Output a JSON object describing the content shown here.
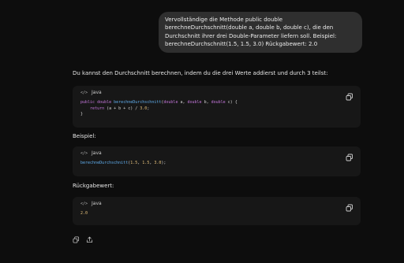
{
  "user_message": "Vervollständige die Methode public double berechneDurchschnitt(double a, double b, double c), die den Durchschnitt ihrer drei Double-Parameter liefern soll. Beispiel: berechneDurchschnitt(1.5, 1.5, 3.0) Rückgabewert: 2.0",
  "assistant": {
    "intro": "Du kannst den Durchschnitt berechnen, indem du die drei Werte addierst und durch 3 teilst:",
    "example_label": "Beispiel:",
    "return_label": "Rückgabewert:"
  },
  "code_blocks": [
    {
      "language": "Java",
      "lines": [
        [
          {
            "t": "public ",
            "c": "kw"
          },
          {
            "t": "double ",
            "c": "kw"
          },
          {
            "t": "berechneDurchschnitt",
            "c": "fn"
          },
          {
            "t": "(",
            "c": "pn"
          },
          {
            "t": "double ",
            "c": "kw"
          },
          {
            "t": "a, ",
            "c": "pn"
          },
          {
            "t": "double ",
            "c": "kw"
          },
          {
            "t": "b, ",
            "c": "pn"
          },
          {
            "t": "double ",
            "c": "kw"
          },
          {
            "t": "c) {",
            "c": "pn"
          }
        ],
        [
          {
            "t": "    ",
            "c": "pn"
          },
          {
            "t": "return ",
            "c": "kw"
          },
          {
            "t": "(a + b + c) / ",
            "c": "pn"
          },
          {
            "t": "3.0",
            "c": "num"
          },
          {
            "t": ";",
            "c": "pn"
          }
        ],
        [
          {
            "t": "}",
            "c": "pn"
          }
        ]
      ]
    },
    {
      "language": "Java",
      "lines": [
        [
          {
            "t": "berechneDurchschnitt",
            "c": "fn"
          },
          {
            "t": "(",
            "c": "pn"
          },
          {
            "t": "1.5",
            "c": "num"
          },
          {
            "t": ", ",
            "c": "pn"
          },
          {
            "t": "1.5",
            "c": "num"
          },
          {
            "t": ", ",
            "c": "pn"
          },
          {
            "t": "3.0",
            "c": "num"
          },
          {
            "t": ");",
            "c": "pn"
          }
        ]
      ]
    },
    {
      "language": "Java",
      "lines": [
        [
          {
            "t": "2.0",
            "c": "num"
          }
        ]
      ]
    }
  ],
  "icons": {
    "language": "code-brackets-icon",
    "copy": "copy-icon",
    "share": "share-icon"
  },
  "colors": {
    "background": "#0d0d0d",
    "bubble": "#2f2f2f",
    "code_background": "#171717",
    "keyword": "#c678dd",
    "function": "#61afef",
    "number": "#e5c07b"
  }
}
